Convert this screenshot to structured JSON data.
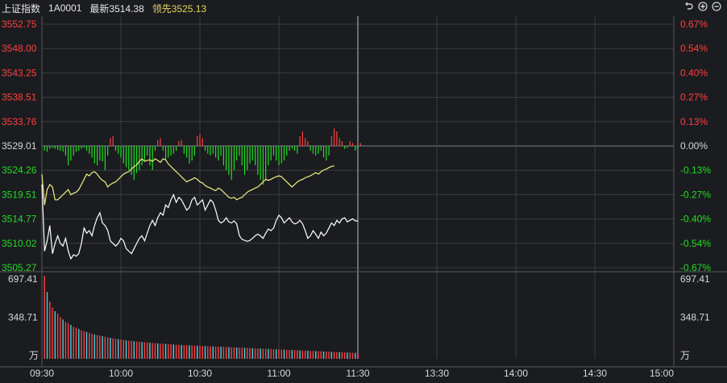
{
  "header": {
    "name": "上证指数",
    "code": "1A0001",
    "latest": "最新3514.38",
    "leading": "领先3525.13"
  },
  "toolbar_icons": [
    "undo-icon",
    "zoom-in-icon",
    "zoom-out-icon"
  ],
  "colors": {
    "up": "#ff4040",
    "down": "#22dd22",
    "flat": "#d9d9d9",
    "price_line": "#ffffff",
    "leading_line": "#f0f080",
    "vol_red": "#ff4040",
    "vol_cyan": "#4dd0e1",
    "grid": "#3a3c42"
  },
  "chart_data": {
    "type": "line",
    "title": "",
    "price_axis_left": [
      "3552.75",
      "3548.00",
      "3543.25",
      "3538.51",
      "3533.76",
      "3529.01",
      "3524.26",
      "3519.51",
      "3514.77",
      "3510.02",
      "3505.27"
    ],
    "pct_axis_right": [
      "0.67%",
      "0.54%",
      "0.40%",
      "0.27%",
      "0.13%",
      "0.00%",
      "-0.13%",
      "-0.27%",
      "-0.40%",
      "-0.54%",
      "-0.67%"
    ],
    "prev_close": 3529.01,
    "ylim": [
      3505.27,
      3552.75
    ],
    "time_ticks": [
      "09:30",
      "10:00",
      "10:30",
      "11:00",
      "11:30",
      "13:30",
      "14:00",
      "14:30",
      "15:00"
    ],
    "minutes_total": 240,
    "minutes_elapsed": 120,
    "series": [
      {
        "key": "price",
        "values": [
          3521.5,
          3508.5,
          3510.5,
          3513.5,
          3508.0,
          3510.0,
          3511.5,
          3510.0,
          3509.5,
          3511.0,
          3508.5,
          3507.0,
          3507.8,
          3507.5,
          3508.0,
          3510.0,
          3513.0,
          3512.0,
          3512.5,
          3511.5,
          3513.5,
          3515.0,
          3516.0,
          3514.0,
          3513.5,
          3512.5,
          3510.5,
          3510.0,
          3509.5,
          3510.0,
          3511.0,
          3510.5,
          3509.0,
          3508.5,
          3508.0,
          3509.0,
          3510.0,
          3511.0,
          3511.5,
          3510.5,
          3512.0,
          3513.5,
          3514.5,
          3513.5,
          3515.0,
          3516.0,
          3515.5,
          3517.5,
          3517.0,
          3518.5,
          3519.5,
          3518.0,
          3519.0,
          3518.5,
          3517.5,
          3516.5,
          3517.0,
          3518.5,
          3519.0,
          3517.5,
          3518.0,
          3518.5,
          3516.5,
          3517.5,
          3518.5,
          3518.0,
          3516.5,
          3514.5,
          3514.0,
          3514.3,
          3515.0,
          3514.2,
          3514.0,
          3514.4,
          3513.8,
          3511.5,
          3510.8,
          3510.6,
          3510.4,
          3510.6,
          3511.0,
          3511.5,
          3511.8,
          3511.5,
          3511.0,
          3512.0,
          3512.8,
          3512.5,
          3513.0,
          3514.5,
          3515.5,
          3515.0,
          3514.0,
          3514.5,
          3515.0,
          3514.2,
          3513.8,
          3514.0,
          3514.5,
          3513.8,
          3512.5,
          3511.0,
          3511.5,
          3512.5,
          3511.8,
          3511.0,
          3512.2,
          3511.5,
          3512.0,
          3513.0,
          3514.0,
          3513.5,
          3514.5,
          3514.0,
          3514.8,
          3515.0,
          3514.2,
          3514.5,
          3514.8,
          3514.4,
          3514.38
        ]
      },
      {
        "key": "leading",
        "values": [
          3523.5,
          3517.5,
          3520.5,
          3521.5,
          3521.0,
          3518.5,
          3518.5,
          3519.0,
          3519.5,
          3520.0,
          3520.5,
          3519.5,
          3519.8,
          3520.0,
          3520.5,
          3521.5,
          3522.5,
          3523.5,
          3523.2,
          3523.8,
          3524.0,
          3523.5,
          3522.8,
          3522.3,
          3522.0,
          3521.0,
          3521.5,
          3521.8,
          3522.0,
          3522.5,
          3523.0,
          3523.5,
          3523.8,
          3524.0,
          3524.5,
          3525.0,
          3525.3,
          3526.0,
          3526.5,
          3526.0,
          3526.2,
          3526.3,
          3526.0,
          3526.5,
          3526.2,
          3525.8,
          3526.5,
          3526.3,
          3525.5,
          3525.0,
          3524.5,
          3524.0,
          3523.5,
          3523.0,
          3522.5,
          3522.0,
          3522.3,
          3522.5,
          3522.8,
          3522.5,
          3522.0,
          3521.8,
          3521.3,
          3521.0,
          3520.8,
          3520.5,
          3520.3,
          3520.8,
          3520.5,
          3520.0,
          3519.5,
          3519.0,
          3518.8,
          3519.0,
          3518.5,
          3518.8,
          3519.0,
          3519.5,
          3520.0,
          3520.3,
          3520.5,
          3520.8,
          3521.0,
          3521.5,
          3522.0,
          3522.5,
          3522.3,
          3522.5,
          3522.8,
          3523.0,
          3523.2,
          3523.0,
          3522.5,
          3522.0,
          3521.5,
          3521.0,
          3521.5,
          3522.0,
          3522.3,
          3522.5,
          3522.8,
          3523.0,
          3523.2,
          3523.5,
          3523.8,
          3523.5,
          3524.0,
          3524.3,
          3524.5,
          3524.8,
          3525.0,
          3525.13
        ]
      },
      {
        "key": "breadth",
        "values": [
          -0.5,
          -0.6,
          -0.3,
          -0.2,
          -0.3,
          -0.4,
          -0.5,
          -0.6,
          -1.0,
          -2.0,
          -1.5,
          -1.0,
          -0.6,
          -0.5,
          -0.3,
          -0.2,
          -0.5,
          -0.8,
          -1.2,
          -1.8,
          -2.0,
          -1.5,
          -1.6,
          -2.5,
          -1.0,
          0.8,
          1.0,
          -0.5,
          -0.8,
          -1.2,
          -1.8,
          -2.2,
          -2.5,
          -3.0,
          -3.5,
          -2.8,
          -2.5,
          -2.0,
          -1.5,
          -1.0,
          -2.0,
          -2.5,
          -0.5,
          0.6,
          0.8,
          -0.5,
          -1.5,
          -1.2,
          -1.0,
          -0.8,
          -0.5,
          0.5,
          0.6,
          -0.8,
          -1.2,
          -1.8,
          -1.5,
          -1.0,
          1.0,
          1.2,
          0.8,
          -0.5,
          -0.8,
          -1.0,
          -0.8,
          -1.2,
          -1.5,
          -1.0,
          -2.0,
          -2.5,
          -3.0,
          -3.5,
          -2.5,
          -1.5,
          -1.0,
          -2.0,
          -3.0,
          -2.5,
          -1.8,
          -1.5,
          -2.0,
          -3.0,
          -3.5,
          -4.0,
          -3.5,
          -2.0,
          -1.5,
          -1.0,
          -1.5,
          -2.0,
          -1.8,
          -1.5,
          -1.0,
          -0.5,
          -0.3,
          -0.5,
          -0.8,
          1.0,
          1.5,
          0.8,
          0.5,
          -0.5,
          -0.8,
          -1.0,
          -0.8,
          -0.5,
          -1.2,
          -1.5,
          -1.0,
          1.0,
          1.8,
          1.5,
          0.8,
          0.5,
          -0.3,
          -0.2,
          0.5,
          0.3,
          -0.5,
          -0.3,
          0.3
        ]
      },
      {
        "key": "volume",
        "values": [
          697.41,
          560,
          480,
          430,
          400,
          380,
          350,
          330,
          310,
          300,
          285,
          270,
          260,
          250,
          240,
          232,
          225,
          218,
          212,
          205,
          200,
          195,
          190,
          185,
          180,
          176,
          172,
          168,
          165,
          162,
          158,
          155,
          152,
          150,
          148,
          145,
          143,
          141,
          139,
          137,
          135,
          133,
          131,
          130,
          128,
          126,
          125,
          123,
          122,
          120,
          118,
          117,
          116,
          115,
          114,
          113,
          112,
          111,
          110,
          109,
          108,
          107,
          106,
          105,
          104,
          103,
          102,
          101,
          100,
          99,
          98,
          97,
          96,
          95,
          94,
          93,
          92,
          91,
          90,
          89,
          88,
          87,
          86,
          85,
          84,
          83,
          82,
          81,
          80,
          79,
          78,
          77,
          76,
          75,
          74,
          73,
          72,
          71,
          70,
          69,
          68,
          67,
          66,
          65,
          64,
          63,
          62,
          61,
          60,
          59,
          58,
          57,
          56,
          55,
          54,
          53,
          52,
          51,
          50,
          49
        ]
      }
    ],
    "volume_axis": [
      "697.41",
      "348.71",
      "万"
    ]
  }
}
